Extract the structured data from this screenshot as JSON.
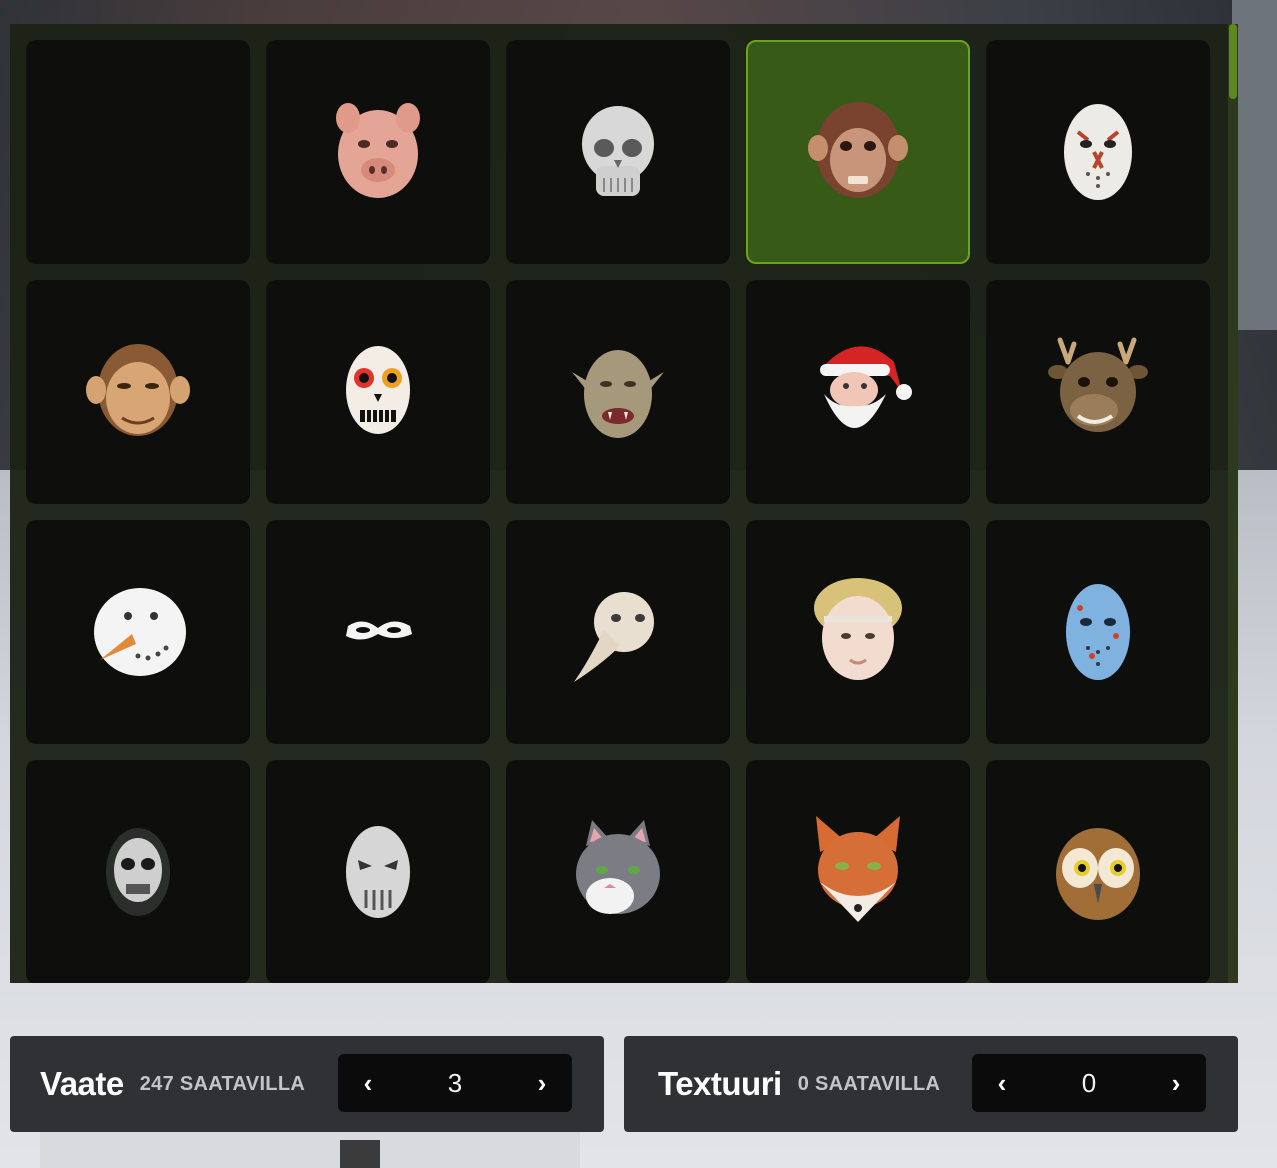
{
  "grid": {
    "items": [
      {
        "name": "empty-mask-tile",
        "icon": "empty-slot-icon"
      },
      {
        "name": "pig-mask-tile",
        "icon": "pig-mask-icon"
      },
      {
        "name": "skull-mask-tile",
        "icon": "skull-mask-icon"
      },
      {
        "name": "monkey-mask-tile",
        "icon": "monkey-mask-icon",
        "selected": true
      },
      {
        "name": "hockey-mask-tile",
        "icon": "hockey-mask-icon"
      },
      {
        "name": "chimp-mask-tile",
        "icon": "chimp-mask-icon"
      },
      {
        "name": "sugar-skull-mask-tile",
        "icon": "sugar-skull-mask-icon"
      },
      {
        "name": "orc-mask-tile",
        "icon": "orc-mask-icon"
      },
      {
        "name": "santa-mask-tile",
        "icon": "santa-mask-icon"
      },
      {
        "name": "reindeer-mask-tile",
        "icon": "reindeer-mask-icon"
      },
      {
        "name": "snowman-mask-tile",
        "icon": "snowman-mask-icon"
      },
      {
        "name": "eye-mask-tile",
        "icon": "eye-mask-icon"
      },
      {
        "name": "plague-doctor-mask-tile",
        "icon": "plague-doctor-mask-icon"
      },
      {
        "name": "cherub-mask-tile",
        "icon": "cherub-mask-icon"
      },
      {
        "name": "blue-hockey-mask-tile",
        "icon": "blue-hockey-mask-icon"
      },
      {
        "name": "metal-skull-mask-tile",
        "icon": "metal-skull-mask-icon"
      },
      {
        "name": "slasher-mask-tile",
        "icon": "slasher-mask-icon"
      },
      {
        "name": "cat-mask-tile",
        "icon": "cat-mask-icon"
      },
      {
        "name": "fox-mask-tile",
        "icon": "fox-mask-icon"
      },
      {
        "name": "owl-mask-tile",
        "icon": "owl-mask-icon"
      }
    ]
  },
  "clothing": {
    "title": "Vaate",
    "available": "247 SAATAVILLA",
    "value": "3",
    "prev": "‹",
    "next": "›"
  },
  "texture": {
    "title": "Textuuri",
    "available": "0 SAATAVILLA",
    "value": "0",
    "prev": "‹",
    "next": "›"
  },
  "colors": {
    "accent": "#6aa31e",
    "selected_bg": "#375a16",
    "panel": "#2f3135",
    "tile": "#0e0f0c"
  }
}
